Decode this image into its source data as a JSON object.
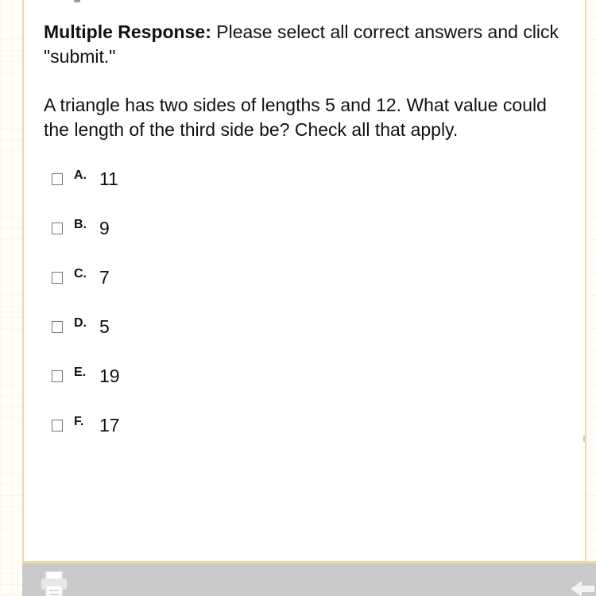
{
  "instructions": {
    "lead": "Multiple Response:",
    "text": " Please select all correct answers and click \"submit.\""
  },
  "question": {
    "text": "A triangle has two sides of lengths 5 and 12. What value could the length of the third side be? Check all that apply."
  },
  "options": [
    {
      "letter": "A.",
      "value": "11"
    },
    {
      "letter": "B.",
      "value": "9"
    },
    {
      "letter": "C.",
      "value": "7"
    },
    {
      "letter": "D.",
      "value": "5"
    },
    {
      "letter": "E.",
      "value": "19"
    },
    {
      "letter": "F.",
      "value": "17"
    }
  ],
  "icons": {
    "print": "print-icon",
    "back": "back-arrow-icon"
  },
  "colors": {
    "accent_border": "#f1d9a6",
    "toolbar": "#c9c9c9"
  }
}
